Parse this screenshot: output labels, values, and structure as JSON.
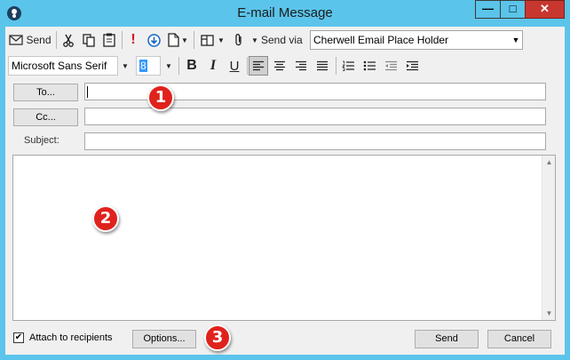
{
  "window": {
    "title": "E-mail Message",
    "minimize_glyph": "—",
    "maximize_glyph": "□",
    "close_glyph": "✕"
  },
  "toolbar": {
    "send_label": "Send",
    "send_via_label": "Send via",
    "send_via_value": "Cherwell Email Place Holder",
    "font_value": "Microsoft Sans Serif",
    "font_size_value": "8",
    "bold_label": "B",
    "italic_label": "I",
    "underline_label": "U",
    "importance_glyph": "!"
  },
  "fields": {
    "to_button": "To...",
    "cc_button": "Cc...",
    "subject_label": "Subject:",
    "to_value": "",
    "cc_value": "",
    "subject_value": "",
    "body_value": ""
  },
  "footer": {
    "attach_label": "Attach to recipients",
    "attach_checked": "✔",
    "options_button": "Options...",
    "send_button": "Send",
    "cancel_button": "Cancel"
  },
  "callouts": [
    "1",
    "2",
    "3"
  ],
  "colors": {
    "titlebar": "#5bc4ea",
    "close_button": "#c7372f",
    "callout": "#e0221c",
    "chrome": "#f0f0f0"
  }
}
